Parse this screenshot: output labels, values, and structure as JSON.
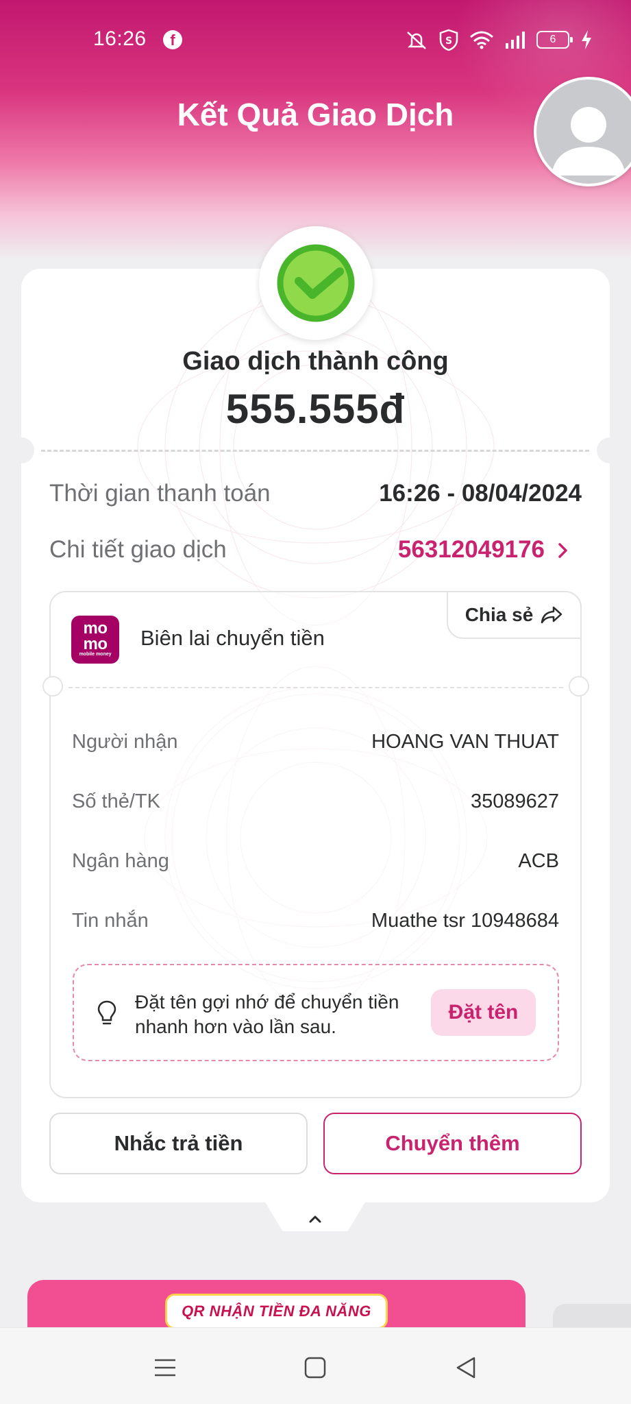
{
  "status_bar": {
    "time": "16:26",
    "battery_level": "6",
    "icons": [
      "facebook-icon",
      "mute-icon",
      "vpn-shield-icon",
      "wifi-icon",
      "signal-icon",
      "battery-icon",
      "charging-icon"
    ]
  },
  "header": {
    "title": "Kết Quả Giao Dịch"
  },
  "result": {
    "status": "Giao dịch thành công",
    "amount": "555.555đ"
  },
  "summary": {
    "time_label": "Thời gian thanh toán",
    "time_value": "16:26 - 08/04/2024",
    "detail_label": "Chi tiết giao dịch",
    "detail_value": "56312049176"
  },
  "receipt": {
    "logo_line1": "mo",
    "logo_line2": "mo",
    "logo_tagline": "mobile money",
    "title": "Biên lai chuyển tiền",
    "share_label": "Chia sẻ",
    "rows": [
      {
        "label": "Người nhận",
        "value": "HOANG VAN THUAT"
      },
      {
        "label": "Số thẻ/TK",
        "value": "35089627"
      },
      {
        "label": "Ngân hàng",
        "value": "ACB"
      },
      {
        "label": "Tin nhắn",
        "value": "Muathe tsr 10948684"
      }
    ],
    "hint_text": "Đặt tên gợi nhớ để chuyển tiền nhanh hơn vào lần sau.",
    "hint_button": "Đặt tên"
  },
  "actions": {
    "remind_label": "Nhắc trả tiền",
    "transfer_more_label": "Chuyển thêm"
  },
  "promo": {
    "badge": "QR NHẬN TIỀN ĐA NĂNG"
  },
  "colors": {
    "brand_pink": "#c9226f",
    "success_green": "#5cc62a",
    "momo_purple": "#a50064"
  }
}
